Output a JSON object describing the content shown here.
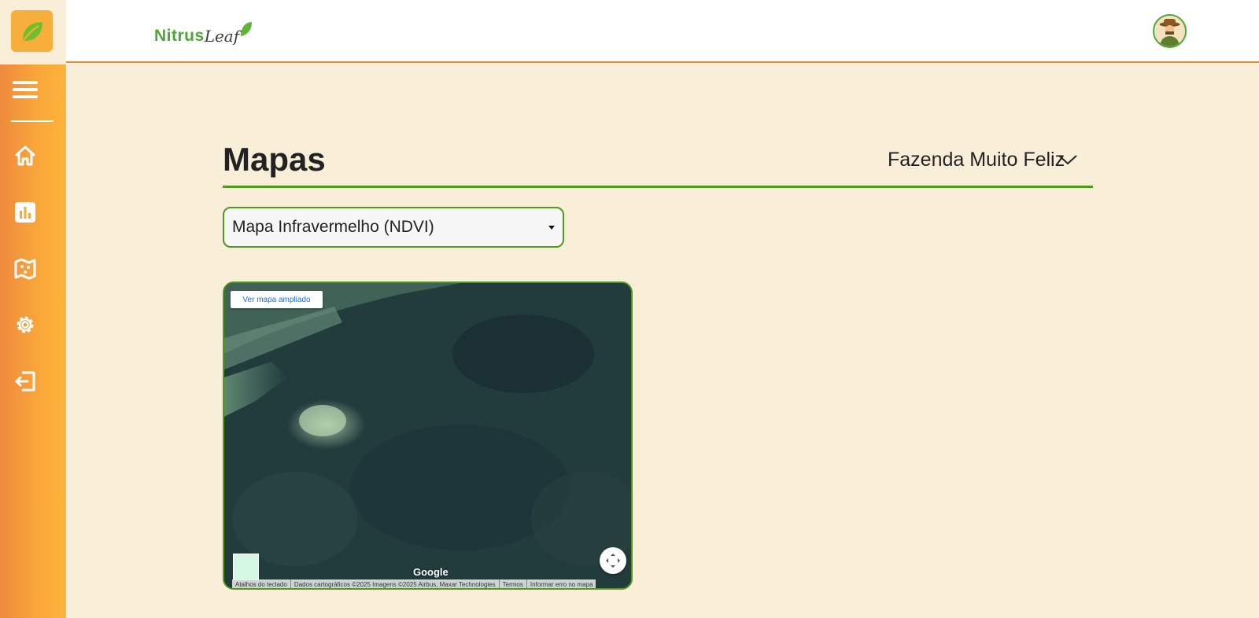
{
  "header": {
    "brand_part1": "Nitrus",
    "brand_part2": "Leaf"
  },
  "sidebar": {
    "items": [
      {
        "name": "menu",
        "icon": "menu-icon"
      },
      {
        "name": "home",
        "icon": "home-icon"
      },
      {
        "name": "dashboard",
        "icon": "bar-chart-icon"
      },
      {
        "name": "maps",
        "icon": "map-icon"
      },
      {
        "name": "settings",
        "icon": "gear-icon"
      },
      {
        "name": "logout",
        "icon": "logout-icon"
      }
    ]
  },
  "main": {
    "title": "Mapas",
    "farm_select": "Fazenda Muito Feliz",
    "map_type": "Mapa Infravermelho (NDVI)"
  },
  "map": {
    "larger_map_label": "Ver mapa ampliado",
    "google_label": "Google",
    "attribution": {
      "shortcuts": "Atalhos do teclado",
      "data": "Dados cartográficos ©2025 Imagens ©2025 Airbus, Maxar Technologies",
      "terms": "Termos",
      "report": "Informar erro no mapa"
    }
  },
  "colors": {
    "accent_orange": "#f9a83a",
    "accent_green": "#4f9a1f",
    "background": "#f9eed8"
  }
}
